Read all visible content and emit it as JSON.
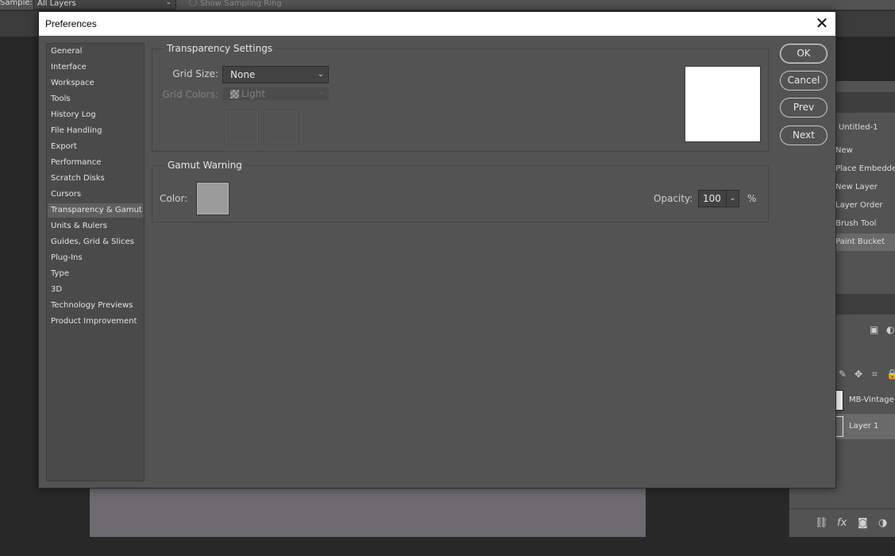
{
  "app": {
    "options_bar": {
      "sample_label": "Sample:",
      "sample_value": "All Layers",
      "show_sampling_ring": "Show Sampling Ring"
    },
    "history_panel": {
      "items": [
        "Untitled-1",
        "New",
        "Place Embedded",
        "New Layer",
        "Layer Order",
        "Brush Tool",
        "Paint Bucket"
      ],
      "selected": "Paint Bucket"
    },
    "layers_panel": {
      "layers": [
        {
          "name": "MB-Vintage-C"
        },
        {
          "name": "Layer 1"
        }
      ]
    }
  },
  "dialog": {
    "title": "Preferences",
    "close_glyph": "✕",
    "nav": {
      "items": [
        {
          "label": "General"
        },
        {
          "label": "Interface"
        },
        {
          "label": "Workspace"
        },
        {
          "label": "Tools"
        },
        {
          "label": "History Log"
        },
        {
          "label": "File Handling"
        },
        {
          "label": "Export"
        },
        {
          "label": "Performance"
        },
        {
          "label": "Scratch Disks"
        },
        {
          "label": "Cursors"
        },
        {
          "label": "Transparency & Gamut"
        },
        {
          "label": "Units & Rulers"
        },
        {
          "label": "Guides, Grid & Slices"
        },
        {
          "label": "Plug-Ins"
        },
        {
          "label": "Type"
        },
        {
          "label": "3D"
        },
        {
          "label": "Technology Previews"
        },
        {
          "label": "Product Improvement"
        }
      ],
      "active": "Transparency & Gamut"
    },
    "transparency": {
      "title": "Transparency Settings",
      "grid_size_label": "Grid Size:",
      "grid_size_value": "None",
      "grid_colors_label": "Grid Colors:",
      "grid_colors_value": "Light"
    },
    "gamut": {
      "title": "Gamut Warning",
      "color_label": "Color:",
      "color_value": "#9b9b9b",
      "opacity_label": "Opacity:",
      "opacity_value": "100",
      "opacity_unit": "%"
    },
    "buttons": {
      "ok": "OK",
      "cancel": "Cancel",
      "prev": "Prev",
      "next": "Next"
    }
  }
}
